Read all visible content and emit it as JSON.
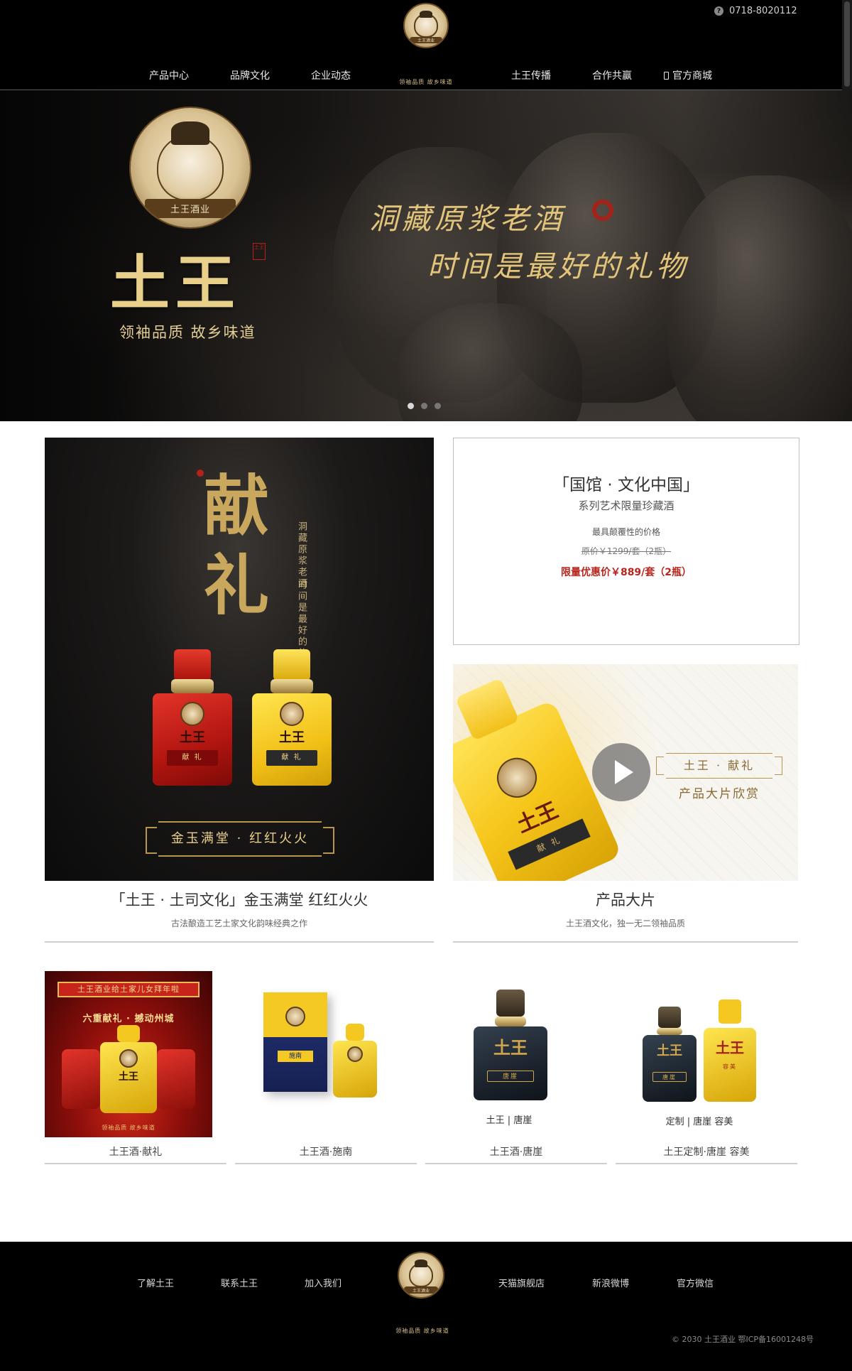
{
  "header": {
    "phone": "0718-8020112",
    "nav_left": [
      "产品中心",
      "品牌文化",
      "企业动态"
    ],
    "nav_right": [
      "土王传播",
      "合作共赢",
      "官方商城"
    ],
    "tagline": "领袖品质  故乡味道",
    "logo_text": "土王酒业"
  },
  "banner": {
    "brand": "土王",
    "tagline": "领袖品质  故乡味道",
    "slogan_line1": "洞藏原浆老酒",
    "slogan_line2": "时间是最好的礼物",
    "seal_text": "土王",
    "slides": 3,
    "active_slide": 1
  },
  "feature_left": {
    "headline": "献礼",
    "vertical_1": "洞藏原浆老酒",
    "vertical_2": "时间是最好的礼物",
    "bottle_red_label": "献  礼",
    "bottle_yellow_label": "献  礼",
    "bottle_mark": "土王",
    "frame_text": "金玉满堂 · 红红火火",
    "title": "「土王 · 土司文化」金玉满堂 红红火火",
    "subtitle": "古法酿造工艺土家文化韵味经典之作"
  },
  "promo": {
    "title": "「国馆 · 文化中国」",
    "series": "系列艺术限量珍藏酒",
    "note": "最具颠覆性的价格",
    "original_price": "原价￥1299/套（2瓶）",
    "deal_price": "限量优惠价￥889/套（2瓶）"
  },
  "video": {
    "frame_text": "土王 · 献礼",
    "caption": "产品大片欣赏",
    "bottle_mark": "土王",
    "bottle_label": "献 礼",
    "title": "产品大片",
    "subtitle": "土王酒文化，独一无二领袖品质"
  },
  "products": [
    {
      "name": "土王酒·献礼",
      "banner": "土王酒业给土家儿女拜年啦",
      "subtitle": "六重献礼 · 撼动州城",
      "foot": "领袖品质  故乡味道"
    },
    {
      "name": "土王酒·施南",
      "label": "施南"
    },
    {
      "name": "土王酒·唐崖",
      "caption": "土王 | 唐崖",
      "label": "唐崖"
    },
    {
      "name": "土王定制·唐崖 容美",
      "caption": "定制 | 唐崖 容美",
      "label_left": "唐崖",
      "label_right": "容美"
    }
  ],
  "footer": {
    "links_left": [
      "了解土王",
      "联系土王",
      "加入我们"
    ],
    "links_right": [
      "天猫旗舰店",
      "新浪微博",
      "官方微信"
    ],
    "tagline": "领袖品质  故乡味道",
    "logo_text": "土王酒业",
    "copyright": "© 2030 土王酒业 鄂ICP备16001248号"
  },
  "colors": {
    "gold": "#e2c47a",
    "deal_red": "#b5261d",
    "header_bg": "#000000"
  }
}
